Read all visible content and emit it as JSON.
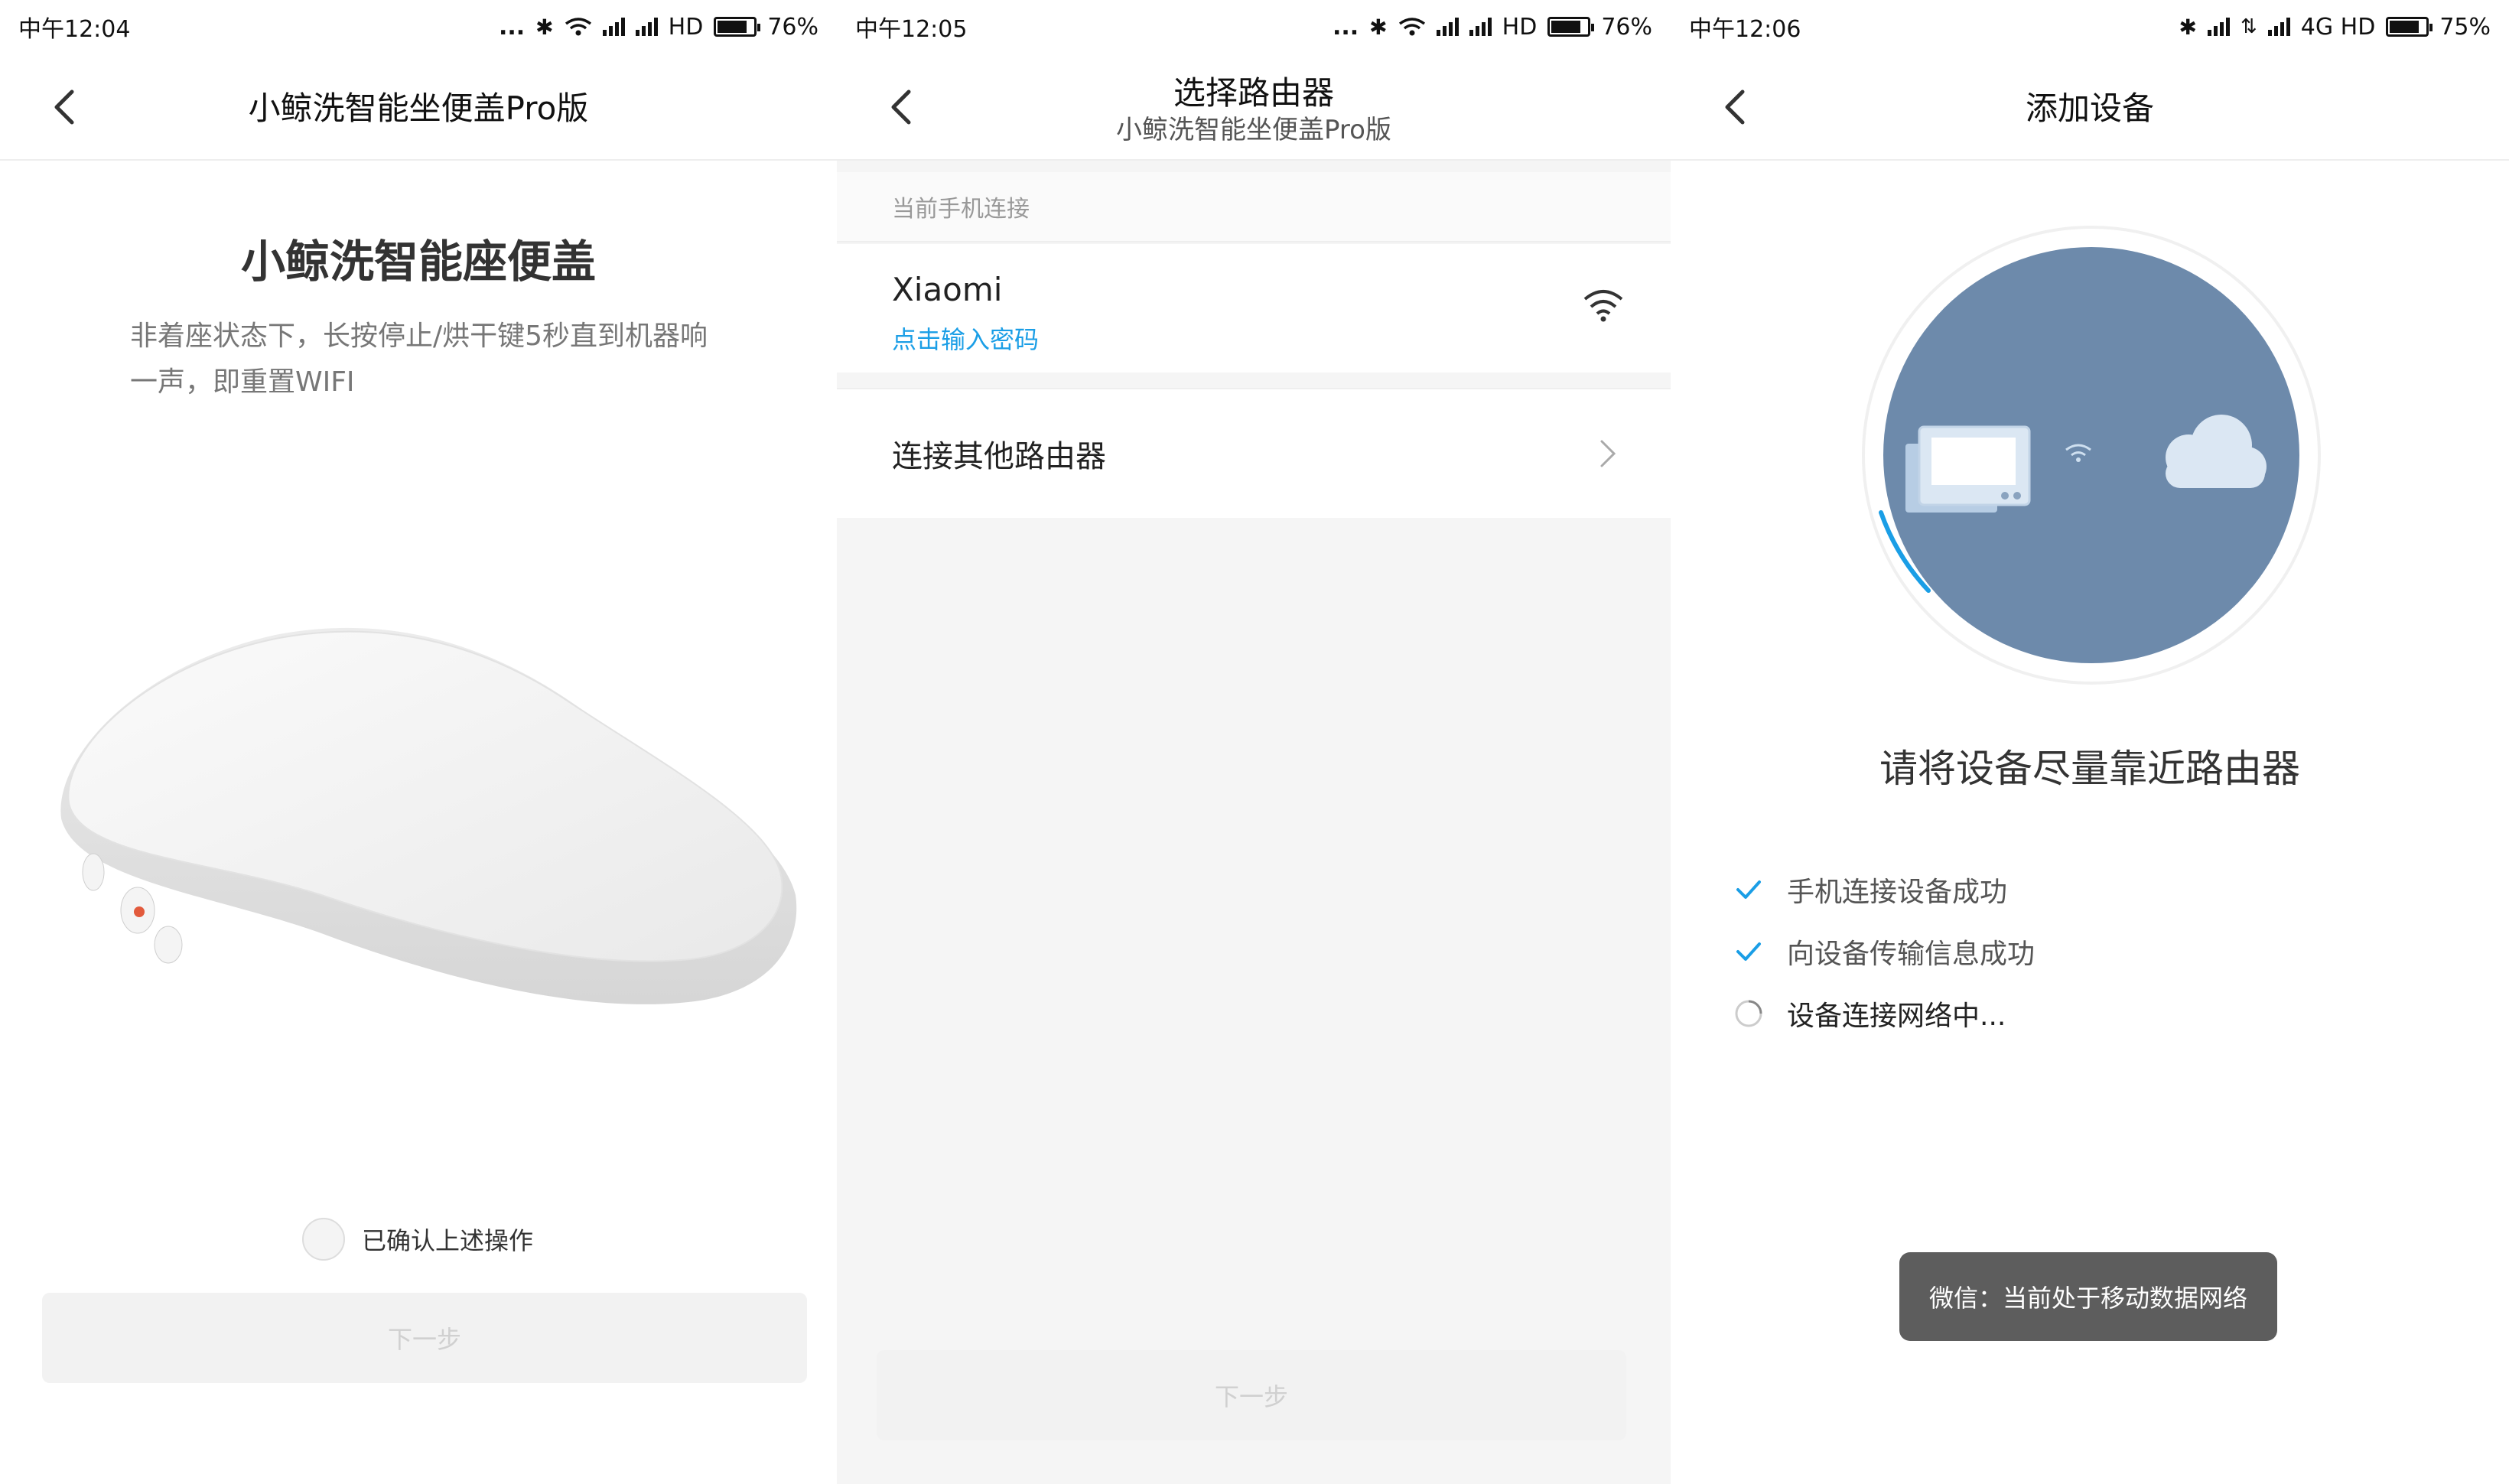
{
  "screens": [
    {
      "status": {
        "time": "中午12:04",
        "dots": "...",
        "network": "HD",
        "battery": "76%"
      },
      "title": "小鲸洗智能坐便盖Pro版",
      "heading": "小鲸洗智能座便盖",
      "description": "非着座状态下，长按停止/烘干键5秒直到机器响一声，即重置WIFI",
      "confirm_label": "已确认上述操作",
      "next_button": "下一步"
    },
    {
      "status": {
        "time": "中午12:05",
        "dots": "...",
        "network": "HD",
        "battery": "76%"
      },
      "title": "选择路由器",
      "subtitle": "小鲸洗智能坐便盖Pro版",
      "section_label": "当前手机连接",
      "network_name": "Xiaomi",
      "password_link": "点击输入密码",
      "other_router": "连接其他路由器",
      "next_button": "下一步"
    },
    {
      "status": {
        "time": "中午12:06",
        "network": "4G HD",
        "battery": "75%"
      },
      "title": "添加设备",
      "message": "请将设备尽量靠近路由器",
      "steps": [
        {
          "label": "手机连接设备成功",
          "state": "done"
        },
        {
          "label": "向设备传输信息成功",
          "state": "done"
        },
        {
          "label": "设备连接网络中...",
          "state": "loading"
        }
      ],
      "toast": "微信：当前处于移动数据网络"
    }
  ],
  "colors": {
    "accent": "#1a9ee6",
    "circle": "#6d8aab",
    "toast_bg": "#5d5d5d",
    "disabled_btn": "#f2f2f2"
  },
  "icons": [
    "back-arrow-icon",
    "wifi-icon",
    "bluetooth-icon",
    "signal-icon",
    "battery-icon",
    "chevron-right-icon",
    "check-icon",
    "spinner-icon",
    "cloud-icon",
    "device-icon"
  ]
}
